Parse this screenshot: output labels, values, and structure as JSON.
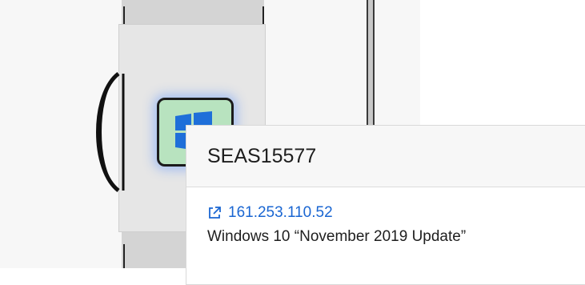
{
  "node": {
    "hostname": "SEAS15577",
    "ip": "161.253.110.52",
    "os": "Windows 10 “November 2019 Update”",
    "icon": "windows-logo-icon",
    "tile_color": "#b8e3bf",
    "highlight_color": "#508cff"
  },
  "colors": {
    "link": "#1a66d2",
    "logo": "#1e6fd9",
    "rack": "#d4d4d4"
  }
}
